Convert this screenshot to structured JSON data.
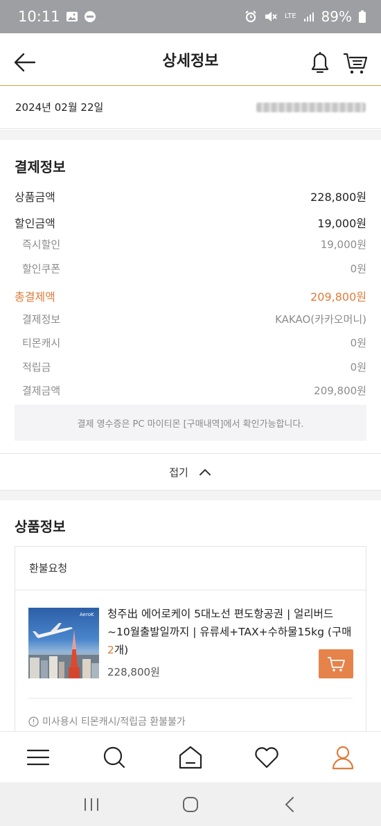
{
  "status_bar": {
    "time": "10:11",
    "network": "LTE",
    "battery": "89%"
  },
  "header": {
    "title": "상세정보",
    "back_icon": "arrow-left-icon",
    "bell_icon": "bell-icon",
    "cart_icon": "cart-icon"
  },
  "order": {
    "date": "2024년 02월 22일"
  },
  "payment": {
    "title": "결제정보",
    "product_amount_label": "상품금액",
    "product_amount": "228,800원",
    "discount_label": "할인금액",
    "discount": "19,000원",
    "instant_discount_label": "즉시할인",
    "instant_discount": "19,000원",
    "coupon_label": "할인쿠폰",
    "coupon": "0원",
    "total_label": "총결제액",
    "total": "209,800원",
    "method_label": "결제정보",
    "method": "KAKAO(카카오머니)",
    "tmon_cash_label": "티몬캐시",
    "tmon_cash": "0원",
    "points_label": "적립금",
    "points": "0원",
    "paid_label": "결제금액",
    "paid": "209,800원",
    "receipt_note": "결제 영수증은 PC 마이티몬 [구매내역]에서 확인가능합니다."
  },
  "collapse": {
    "label": "접기"
  },
  "product_section": {
    "title": "상품정보",
    "status": "환불요청",
    "thumb_brand": "AeroK",
    "name_part1": "청주出 에어로케이 5대노선 편도항공권 | 얼리버드 ~10월출발일까지 | 유류세+TAX+수하물15kg (구매 ",
    "name_qty": "2",
    "name_part2": "개)",
    "price": "228,800원",
    "notice": "미사용시 티몬캐시/적립금 환불불가"
  },
  "bottom_nav": [
    "menu-icon",
    "search-icon",
    "home-icon",
    "heart-icon",
    "user-icon"
  ],
  "colors": {
    "accent": "#e07b39",
    "header_border": "#c9a24a",
    "status_bar": "#9e9fa3"
  }
}
